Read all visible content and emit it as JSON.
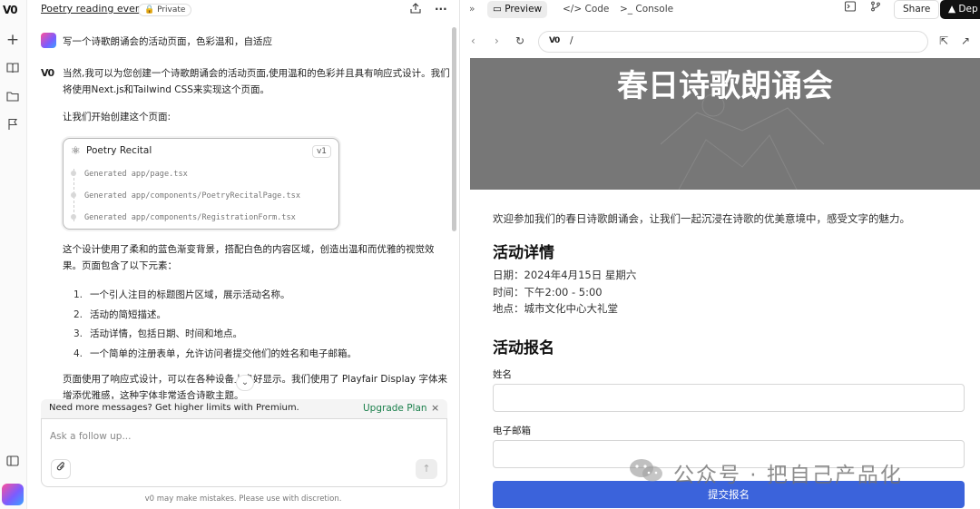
{
  "rail": {
    "logo": "V0"
  },
  "chat": {
    "title": "Poetry reading event",
    "privacy": "Private",
    "user_message": "写一个诗歌朗诵会的活动页面，色彩温和，自适应",
    "assistant": {
      "logo": "V0",
      "intro": "当然,我可以为您创建一个诗歌朗诵会的活动页面,使用温和的色彩并且具有响应式设计。我们将使用Next.js和Tailwind CSS来实现这个页面。",
      "lead": "让我们开始创建这个页面:",
      "card": {
        "title": "Poetry Recital",
        "version": "v1",
        "files": [
          "Generated app/page.tsx",
          "Generated app/components/PoetryRecitalPage.tsx",
          "Generated app/components/RegistrationForm.tsx"
        ]
      },
      "summary": "这个设计使用了柔和的蓝色渐变背景，搭配白色的内容区域，创造出温和而优雅的视觉效果。页面包含了以下元素：",
      "list": [
        {
          "n": "1.",
          "text": "一个引人注目的标题图片区域，展示活动名称。"
        },
        {
          "n": "2.",
          "text": "活动的简短描述。"
        },
        {
          "n": "3.",
          "text": "活动详情，包括日期、时间和地点。"
        },
        {
          "n": "4.",
          "text": "一个简单的注册表单，允许访问者提交他们的姓名和电子邮箱。"
        }
      ],
      "after": "页面使用了响应式设计，可以在各种设备上良好显示。我们使用了 Playfair Display 字体来增添优雅感，这种字体非常适合诗歌主题。"
    },
    "upgrade": {
      "text": "Need more messages? Get higher limits with Premium.",
      "link": "Upgrade Plan"
    },
    "input": {
      "placeholder": "Ask a follow up..."
    },
    "disclaimer": "v0 may make mistakes. Please use with discretion."
  },
  "toolbar": {
    "tabs": [
      {
        "label": "Preview"
      },
      {
        "label": "Code"
      },
      {
        "label": "Console"
      }
    ],
    "share": "Share",
    "deploy": "Dep"
  },
  "address": {
    "badge": "V0",
    "path": "/"
  },
  "page": {
    "hero_title": "春日诗歌朗诵会",
    "intro": "欢迎参加我们的春日诗歌朗诵会，让我们一起沉浸在诗歌的优美意境中，感受文字的魅力。",
    "details_heading": "活动详情",
    "details": [
      "日期：2024年4月15日 星期六",
      "时间：下午2:00 - 5:00",
      "地点：城市文化中心大礼堂"
    ],
    "form_heading": "活动报名",
    "name_label": "姓名",
    "email_label": "电子邮箱",
    "submit": "提交报名"
  },
  "watermark": "公众号 · 把自己产品化"
}
